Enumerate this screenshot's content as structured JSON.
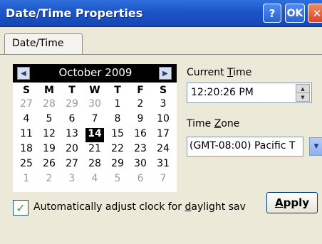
{
  "window": {
    "title": "Date/Time Properties",
    "help_label": "?",
    "ok_label": "OK",
    "close_label": "✕"
  },
  "tabs": [
    {
      "label": "Date/Time"
    }
  ],
  "calendar": {
    "month_label": "October 2009",
    "prev_icon": "◀",
    "next_icon": "▶",
    "weekdays": [
      "S",
      "M",
      "T",
      "W",
      "T",
      "F",
      "S"
    ],
    "weeks": [
      [
        "27",
        "28",
        "29",
        "30",
        "1",
        "2",
        "3"
      ],
      [
        "4",
        "5",
        "6",
        "7",
        "8",
        "9",
        "10"
      ],
      [
        "11",
        "12",
        "13",
        "14",
        "15",
        "16",
        "17"
      ],
      [
        "18",
        "19",
        "20",
        "21",
        "22",
        "23",
        "24"
      ],
      [
        "25",
        "26",
        "27",
        "28",
        "29",
        "30",
        "31"
      ],
      [
        "1",
        "2",
        "3",
        "4",
        "5",
        "6",
        "7"
      ]
    ],
    "selected_day": "14"
  },
  "current_time": {
    "label_pre": "Current ",
    "label_accel": "T",
    "label_post": "ime",
    "value": "12:20:26 PM"
  },
  "time_zone": {
    "label_pre": "Time ",
    "label_accel": "Z",
    "label_post": "one",
    "value": "(GMT-08:00) Pacific T"
  },
  "daylight": {
    "checked": true,
    "label_pre": "Automatically adjust clock for ",
    "label_accel": "d",
    "label_post": "aylight sav"
  },
  "apply_button": {
    "label_accel": "A",
    "label_post": "pply"
  }
}
